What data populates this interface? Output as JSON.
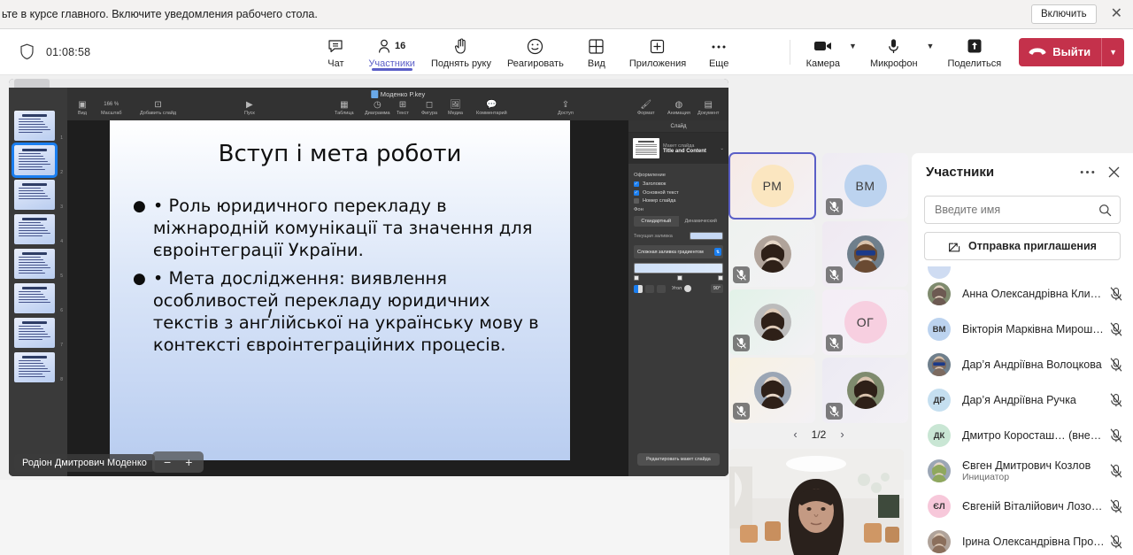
{
  "notification": {
    "text": "ьте в курсе главного. Включите уведомления рабочего стола.",
    "enable_label": "Включить",
    "close_icon": "close-icon"
  },
  "toolbar": {
    "shield_icon": "shield-icon",
    "timer": "01:08:58",
    "items": [
      {
        "label": "Чат",
        "icon": "chat-icon",
        "active": false
      },
      {
        "label": "Участники",
        "icon": "people-icon",
        "badge": "16",
        "active": true
      },
      {
        "label": "Поднять руку",
        "icon": "raise-hand-icon",
        "active": false
      },
      {
        "label": "Реагировать",
        "icon": "reactions-icon",
        "active": false
      },
      {
        "label": "Вид",
        "icon": "view-grid-icon",
        "active": false
      },
      {
        "label": "Приложения",
        "icon": "apps-plus-icon",
        "active": false
      },
      {
        "label": "Еще",
        "icon": "more-horizontal-icon",
        "active": false
      }
    ],
    "camera_label": "Камера",
    "microphone_label": "Микрофон",
    "share_label": "Поделиться",
    "leave_label": "Выйти",
    "leave_color": "#c4314b",
    "accent_color": "#5b5fc7"
  },
  "shared_screen": {
    "app_title": "Моденко P.key",
    "toolbar_left": [
      {
        "label": "Вид",
        "icon": "view-icon"
      },
      {
        "label": "Масштаб",
        "icon": "zoom-percent-icon",
        "value": "166 %"
      },
      {
        "label": "Добавить слайд",
        "icon": "add-slide-icon"
      }
    ],
    "toolbar_play": {
      "label": "Пуск",
      "icon": "play-icon"
    },
    "toolbar_insert": [
      {
        "label": "Таблица",
        "icon": "table-icon"
      },
      {
        "label": "Диаграмма",
        "icon": "chart-icon"
      },
      {
        "label": "Текст",
        "icon": "text-icon"
      },
      {
        "label": "Фигура",
        "icon": "shape-icon"
      },
      {
        "label": "Медиа",
        "icon": "media-icon"
      },
      {
        "label": "Комментарий",
        "icon": "comment-icon"
      }
    ],
    "toolbar_share": {
      "label": "Доступ",
      "icon": "share-up-icon"
    },
    "toolbar_right": [
      {
        "label": "Формат",
        "icon": "format-brush-icon"
      },
      {
        "label": "Анимация",
        "icon": "animate-icon"
      },
      {
        "label": "Документ",
        "icon": "document-icon"
      }
    ],
    "inspector": {
      "section_label": "Слайд",
      "layout_caption": "Макет слайда",
      "layout_value": "Title and Content",
      "appearance_head": "Оформление",
      "appearance_options": [
        {
          "label": "Заголовок",
          "checked": true
        },
        {
          "label": "Основной текст",
          "checked": true
        },
        {
          "label": "Номер слайда",
          "checked": false
        }
      ],
      "background_head": "Фон",
      "segments": [
        {
          "label": "Стандартный",
          "selected": true
        },
        {
          "label": "Динамический",
          "selected": false
        }
      ],
      "current_fill_label": "Текущая заливка",
      "fill_type": "Сложная заливка градиентом",
      "angle_label": "Угол",
      "angle_value": "90°",
      "edit_layout_label": "Редактировать макет слайда"
    },
    "slide": {
      "title": "Вступ і мета роботи",
      "bullets": [
        "• Роль юридичного перекладу в міжнародній комунікації та значення для євроінтеграції України.",
        "• Мета дослідження: виявлення особливостей перекладу юридичних текстів з англійської на українську мову в контексті євроінтеграційних процесів."
      ],
      "total_thumbnails": 8,
      "selected_thumbnail": 2
    },
    "presenter_name": "Родіон Дмитрович Моденко",
    "zoom_out_label": "−",
    "zoom_in_label": "+"
  },
  "tiles": {
    "items": [
      {
        "initials": "РМ",
        "kind": "initials",
        "muted": false,
        "selected": true,
        "avatar_color": "#fbe6c0",
        "bg": "#f6eae6"
      },
      {
        "initials": "ВМ",
        "kind": "initials",
        "muted": true,
        "selected": false,
        "avatar_color": "#bcd3ef",
        "bg": "#efecf3"
      },
      {
        "initials": "",
        "kind": "photo",
        "muted": true,
        "selected": false,
        "bg": "#eef2ef"
      },
      {
        "initials": "",
        "kind": "photo",
        "muted": true,
        "selected": false,
        "bg": "#efe9f2"
      },
      {
        "initials": "",
        "kind": "photo",
        "muted": true,
        "selected": false,
        "bg": "#e2f2e8"
      },
      {
        "initials": "ОГ",
        "kind": "initials",
        "muted": true,
        "selected": false,
        "avatar_color": "#f7cfe0",
        "bg": "#f4eef6"
      },
      {
        "initials": "",
        "kind": "photo",
        "muted": true,
        "selected": false,
        "bg": "#f7f1e2"
      },
      {
        "initials": "",
        "kind": "photo",
        "muted": true,
        "selected": false,
        "bg": "#eceaf3"
      }
    ],
    "page_label": "1/2",
    "prev_icon": "chevron-left-icon",
    "next_icon": "chevron-right-icon"
  },
  "participants_panel": {
    "title": "Участники",
    "more_icon": "more-horizontal-icon",
    "close_icon": "close-icon",
    "search_placeholder": "Введите имя",
    "search_value": "",
    "search_icon": "search-icon",
    "invite_label": "Отправка приглашения",
    "invite_icon": "share-invite-icon",
    "people": [
      {
        "name": "Анна Олександрівна Климен…",
        "role": "",
        "kind": "photo",
        "muted": true,
        "avatar_color": "#6d5a52"
      },
      {
        "name": "Вікторія Марківна Мирошни…",
        "role": "",
        "kind": "initials",
        "initials": "ВМ",
        "muted": true,
        "avatar_color": "#bcd3ef"
      },
      {
        "name": "Дар’я Андріївна Волоцкова",
        "role": "",
        "kind": "photo",
        "muted": true,
        "avatar_color": "#7c6a60"
      },
      {
        "name": "Дар’я Андріївна Ручка",
        "role": "",
        "kind": "initials",
        "initials": "ДР",
        "muted": true,
        "avatar_color": "#c5dff0"
      },
      {
        "name": "Дмитро Коросташ… (внешний)",
        "role": "",
        "kind": "initials",
        "initials": "ДК",
        "muted": true,
        "avatar_color": "#c9e6d4"
      },
      {
        "name": "Євген Дмитрович Козлов",
        "role": "Инициатор",
        "kind": "photo",
        "muted": true,
        "avatar_color": "#8fa85e"
      },
      {
        "name": "Євгеній Віталійович Лозовий",
        "role": "",
        "kind": "initials",
        "initials": "ЄЛ",
        "muted": true,
        "avatar_color": "#f7c8da"
      },
      {
        "name": "Ірина Олександрівна Просол",
        "role": "",
        "kind": "photo",
        "muted": true,
        "avatar_color": "#8b6f5c"
      }
    ],
    "mute_icon": "mic-off-icon"
  }
}
